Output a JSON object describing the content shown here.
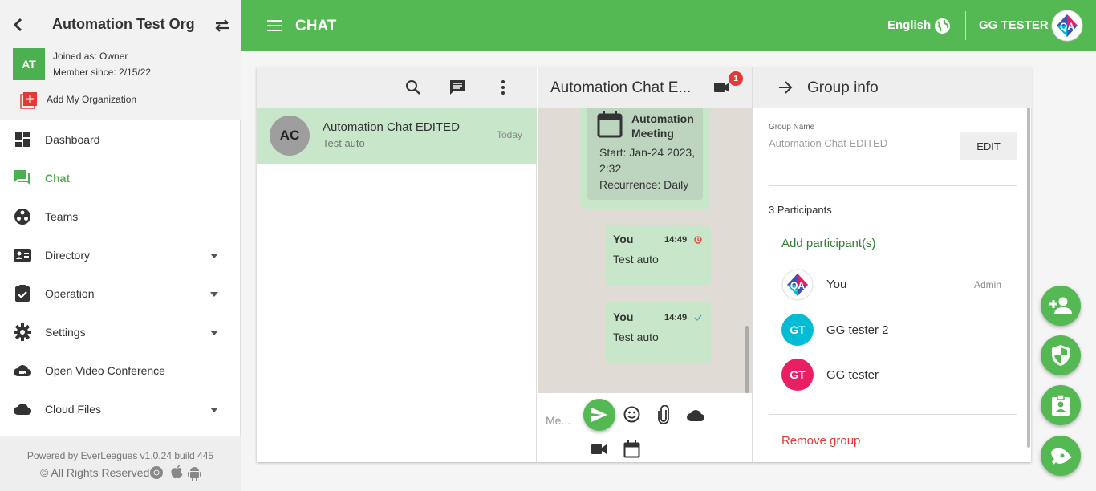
{
  "sidebar": {
    "org_title": "Automation Test Org",
    "initials": "AT",
    "joined": "Joined as: Owner",
    "member_since": "Member since: 2/15/22",
    "add_org": "Add My Organization",
    "items": [
      {
        "label": "Dashboard",
        "icon": "dashboard-icon",
        "active": false
      },
      {
        "label": "Chat",
        "icon": "chat-icon",
        "active": true
      },
      {
        "label": "Teams",
        "icon": "teams-icon",
        "active": false
      },
      {
        "label": "Directory",
        "icon": "contact-card-icon",
        "active": false,
        "expandable": true
      },
      {
        "label": "Operation",
        "icon": "clipboard-check-icon",
        "active": false,
        "expandable": true
      },
      {
        "label": "Settings",
        "icon": "gear-icon",
        "active": false,
        "expandable": true
      },
      {
        "label": "Open Video Conference",
        "icon": "video-cloud-icon",
        "active": false
      },
      {
        "label": "Cloud Files",
        "icon": "cloud-icon",
        "active": false,
        "expandable": true
      }
    ],
    "footer_powered": "Powered by EverLeagues v1.0.24 build 445",
    "footer_rights": "© All Rights Reserved"
  },
  "header": {
    "title": "CHAT",
    "language": "English",
    "user": "GG TESTER",
    "accent": "#54b952"
  },
  "chat_list": {
    "rows": [
      {
        "initials": "AC",
        "title": "Automation Chat EDITED",
        "subtitle": "Test auto",
        "time": "Today"
      }
    ]
  },
  "conversation": {
    "title": "Automation Chat E...",
    "video_badge": "1",
    "meeting": {
      "title_line1": "Automation",
      "title_line2": "Meeting",
      "start_line1": "Start: Jan-24 2023,",
      "start_line2": "2:32",
      "recurrence": "Recurrence: Daily"
    },
    "messages": [
      {
        "sender": "You",
        "time": "14:49",
        "text": "Test auto",
        "status": "pending"
      },
      {
        "sender": "You",
        "time": "14:49",
        "text": "Test auto",
        "status": "sent"
      }
    ],
    "input_placeholder": "Me..."
  },
  "group_info": {
    "title": "Group info",
    "name_label": "Group Name",
    "name_value": "Automation Chat EDITED",
    "edit_label": "EDIT",
    "participant_count": "3 Participants",
    "add_participant": "Add participant(s)",
    "participants": [
      {
        "name": "You",
        "role": "Admin",
        "initials": "",
        "color": "#ffffff"
      },
      {
        "name": "GG tester 2",
        "role": "",
        "initials": "GT",
        "color": "#00bcd4"
      },
      {
        "name": "GG tester",
        "role": "",
        "initials": "GT",
        "color": "#e91e63"
      }
    ],
    "remove_label": "Remove group"
  },
  "fabs": [
    "add-person-icon",
    "shield-icon",
    "badge-icon",
    "rocket-icon"
  ]
}
